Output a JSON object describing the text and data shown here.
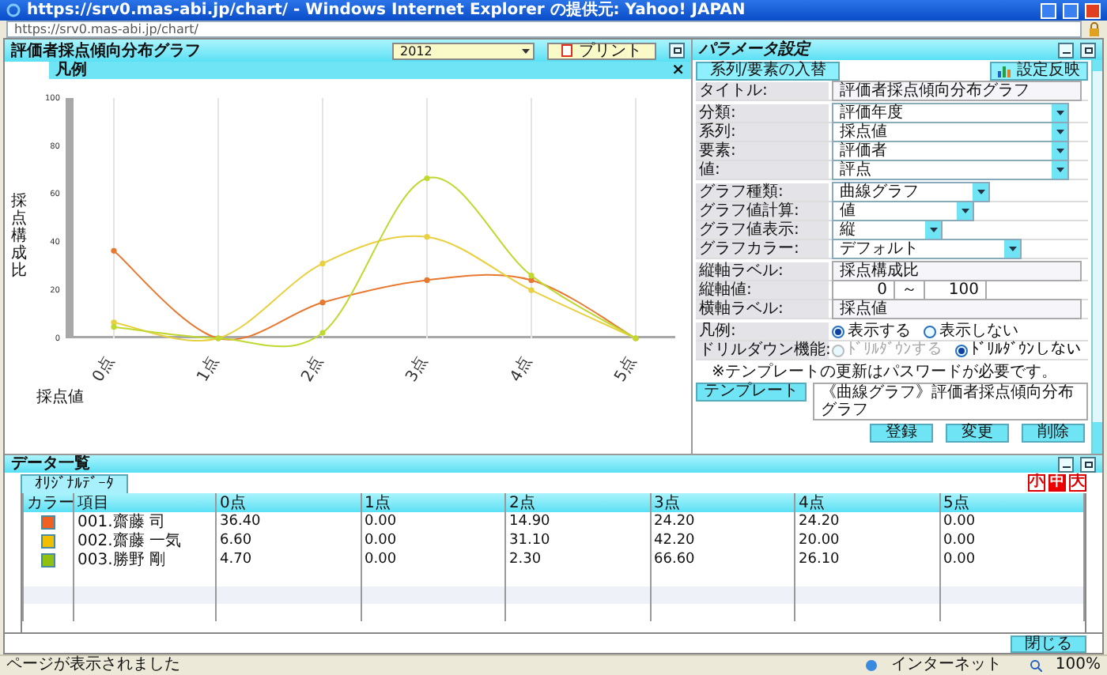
{
  "browser": {
    "title": "https://srv0.mas-abi.jp/chart/ - Windows Internet Explorer の提供元: Yahoo! JAPAN",
    "address": "https://srv0.mas-abi.jp/chart/"
  },
  "chart_panel": {
    "title": "評価者採点傾向分布グラフ",
    "year": "2012",
    "print": "プリント",
    "legend_title": "凡例",
    "legend_close": "×",
    "chart_data": {
      "type": "line",
      "xlabel": "採点値",
      "ylabel": "採点構成比",
      "categories": [
        "0点",
        "1点",
        "2点",
        "3点",
        "4点",
        "5点"
      ],
      "ylim": [
        0,
        100
      ],
      "grid": true,
      "yticks": [
        0,
        20,
        40,
        60,
        80,
        100
      ],
      "series": [
        {
          "color": "#e87830",
          "marker": true,
          "values": [
            36.4,
            0,
            14.9,
            24.2,
            24.2,
            0
          ]
        },
        {
          "color": "#e8d040",
          "marker": true,
          "values": [
            6.6,
            0,
            31.1,
            42.2,
            20,
            0
          ]
        },
        {
          "color": "#c0d830",
          "marker": true,
          "values": [
            4.7,
            0,
            2.3,
            66.6,
            26.1,
            0
          ]
        }
      ]
    }
  },
  "params": {
    "title": "パラメータ設定",
    "swap": "系列/要素の入替",
    "apply": "設定反映",
    "fields": [
      {
        "kind": "text",
        "label": "タイトル:",
        "value": "評価者採点傾向分布グラフ"
      },
      {
        "kind": "select",
        "label": "分類:",
        "value": "評価年度"
      },
      {
        "kind": "select",
        "label": "系列:",
        "value": "採点値"
      },
      {
        "kind": "select",
        "label": "要素:",
        "value": "評価者"
      },
      {
        "kind": "select",
        "label": "値:",
        "value": "評点"
      },
      {
        "kind": "select",
        "label": "グラフ種類:",
        "value": "曲線グラフ"
      },
      {
        "kind": "select",
        "label": "グラフ値計算:",
        "value": "値"
      },
      {
        "kind": "select",
        "label": "グラフ値表示:",
        "value": "縦"
      },
      {
        "kind": "select",
        "label": "グラフカラー:",
        "value": "デフォルト"
      },
      {
        "kind": "text",
        "label": "縦軸ラベル:",
        "value": "採点構成比"
      },
      {
        "kind": "range",
        "label": "縦軸値:",
        "from": "0",
        "sep": "～",
        "to": "100"
      },
      {
        "kind": "text",
        "label": "横軸ラベル:",
        "value": "採点値"
      },
      {
        "kind": "radio",
        "label": "凡例:",
        "options": [
          {
            "label": "表示する",
            "selected": true,
            "disabled": false
          },
          {
            "label": "表示しない",
            "selected": false,
            "disabled": false
          }
        ]
      },
      {
        "kind": "radio",
        "label": "ドリルダウン機能:",
        "options": [
          {
            "label": "ﾄﾞﾘﾙﾀﾞｳﾝする",
            "selected": false,
            "disabled": true
          },
          {
            "label": "ﾄﾞﾘﾙﾀﾞｳﾝしない",
            "selected": true,
            "disabled": false
          }
        ]
      }
    ],
    "note": "※テンプレートの更新はパスワードが必要です。",
    "template_button": "テンプレート",
    "template_value": "《曲線グラフ》評価者採点傾向分布グラフ",
    "actions": [
      "登録",
      "変更",
      "削除"
    ]
  },
  "data_panel": {
    "title": "データ一覧",
    "tab": "ｵﾘｼﾞﾅﾙﾃﾞｰﾀ",
    "sizes": [
      {
        "label": "小",
        "selected": false
      },
      {
        "label": "中",
        "selected": true
      },
      {
        "label": "大",
        "selected": false
      }
    ],
    "columns": [
      "カラー",
      "項目",
      "0点",
      "1点",
      "2点",
      "3点",
      "4点",
      "5点"
    ],
    "rows": [
      {
        "color": "#f06020",
        "label": "001.齋藤 司",
        "values": [
          "36.40",
          "0.00",
          "14.90",
          "24.20",
          "24.20",
          "0.00"
        ]
      },
      {
        "color": "#f0c000",
        "label": "002.齋藤 一気",
        "values": [
          "6.60",
          "0.00",
          "31.10",
          "42.20",
          "20.00",
          "0.00"
        ]
      },
      {
        "color": "#90c010",
        "label": "003.勝野 剛",
        "values": [
          "4.70",
          "0.00",
          "2.30",
          "66.60",
          "26.10",
          "0.00"
        ]
      }
    ]
  },
  "close_button": "閉じる",
  "status": {
    "text": "ページが表示されました",
    "zone": "インターネット",
    "zoom": "100%"
  }
}
